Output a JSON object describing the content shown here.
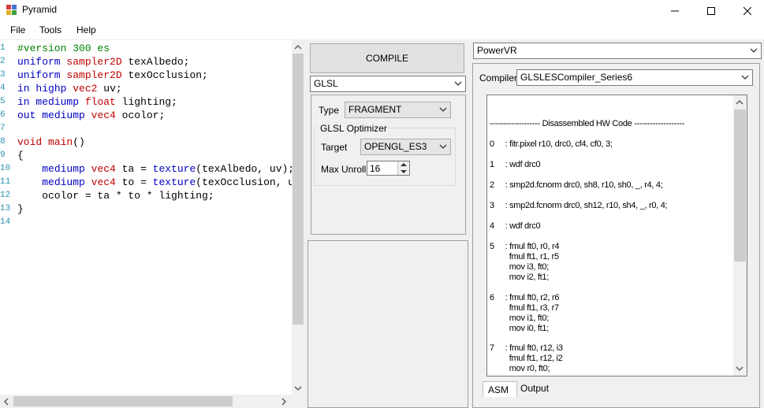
{
  "window": {
    "title": "Pyramid"
  },
  "menu": [
    "File",
    "Tools",
    "Help"
  ],
  "editor": {
    "line_numbers": [
      "1",
      "2",
      "3",
      "4",
      "5",
      "6",
      "7",
      "8",
      "9",
      "10",
      "11",
      "12",
      "13",
      "14"
    ]
  },
  "middle": {
    "compile_label": "COMPILE",
    "language": "GLSL",
    "type_label": "Type",
    "type_value": "FRAGMENT",
    "optimizer_title": "GLSL Optimizer",
    "target_label": "Target",
    "target_value": "OPENGL_ES3",
    "maxunroll_label": "Max Unroll",
    "maxunroll_value": "16"
  },
  "right": {
    "backend": "PowerVR",
    "compiler_label": "Compiler",
    "compiler_value": "GLSLESCompiler_Series6",
    "asm_lines": [
      "------------------- Disassembled HW Code -------------------",
      "0     : fitr.pixel r10, drc0, cf4, cf0, 3;",
      "1     : wdf drc0",
      "2     : smp2d.fcnorm drc0, sh8, r10, sh0, _, r4, 4;",
      "3     : smp2d.fcnorm drc0, sh12, r10, sh4, _, r0, 4;",
      "4     : wdf drc0",
      "5     : fmul ft0, r0, r4",
      "         fmul ft1, r1, r5",
      "         mov i3, ft0;",
      "         mov i2, ft1;",
      "6     : fmul ft0, r2, r6",
      "         fmul ft1, r3, r7",
      "         mov i1, ft0;",
      "         mov i0, ft1;",
      "7     : fmul ft0, r12, i3",
      "         fmul ft1, r12, i2",
      "         mov r0, ft0;"
    ],
    "tabs": [
      "ASM",
      "Output"
    ]
  }
}
